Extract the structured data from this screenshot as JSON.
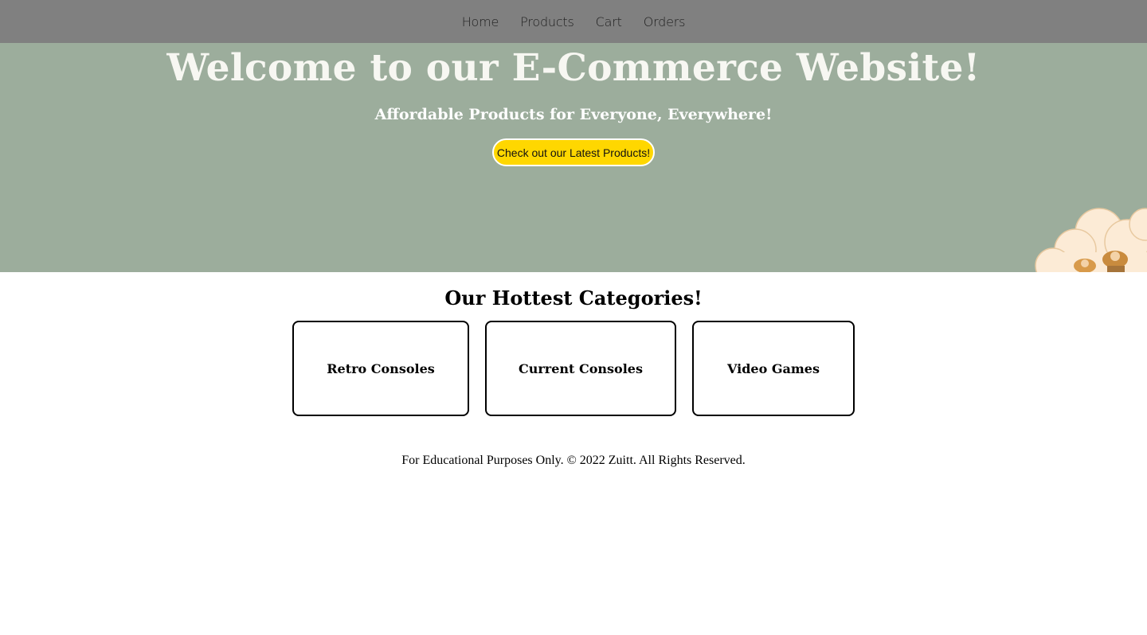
{
  "nav": {
    "items": [
      {
        "label": "Home"
      },
      {
        "label": "Products"
      },
      {
        "label": "Cart"
      },
      {
        "label": "Orders"
      }
    ]
  },
  "hero": {
    "title": "Welcome to our E-Commerce Website!",
    "subtitle": "Affordable Products for Everyone, Everywhere!",
    "cta_label": "Check out our Latest Products!"
  },
  "categories": {
    "heading": "Our Hottest Categories!",
    "items": [
      {
        "label": "Retro Consoles"
      },
      {
        "label": "Current Consoles"
      },
      {
        "label": "Video Games"
      }
    ]
  },
  "footer": {
    "text": "For Educational Purposes Only. © 2022 Zuitt. All Rights Reserved."
  },
  "colors": {
    "navbar_bg": "#808080",
    "hero_bg": "#9cad9c",
    "cta_bg": "#ffd700"
  }
}
